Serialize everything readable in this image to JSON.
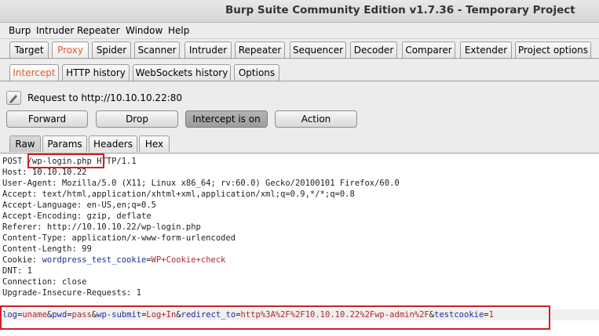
{
  "window": {
    "title": "Burp Suite Community Edition v1.7.36 - Temporary Project"
  },
  "menu": [
    "Burp",
    "Intruder",
    "Repeater",
    "Window",
    "Help"
  ],
  "main_tabs": [
    "Target",
    "Proxy",
    "Spider",
    "Scanner",
    "Intruder",
    "Repeater",
    "Sequencer",
    "Decoder",
    "Comparer",
    "Extender",
    "Project options"
  ],
  "proxy_tabs": [
    "Intercept",
    "HTTP history",
    "WebSockets history",
    "Options"
  ],
  "request_info": "Request to http://10.10.10.22:80",
  "buttons": {
    "forward": "Forward",
    "drop": "Drop",
    "intercept": "Intercept is on",
    "action": "Action"
  },
  "view_tabs": [
    "Raw",
    "Params",
    "Headers",
    "Hex"
  ],
  "request": {
    "method": "POST ",
    "path": "/wp-login.php",
    "protocol": " HTTP/1.1",
    "headers": [
      "Host: 10.10.10.22",
      "User-Agent: Mozilla/5.0 (X11; Linux x86_64; rv:60.0) Gecko/20100101 Firefox/60.0",
      "Accept: text/html,application/xhtml+xml,application/xml;q=0.9,*/*;q=0.8",
      "Accept-Language: en-US,en;q=0.5",
      "Accept-Encoding: gzip, deflate",
      "Referer: http://10.10.10.22/wp-login.php",
      "Content-Type: application/x-www-form-urlencoded",
      "Content-Length: 99"
    ],
    "cookie": {
      "prefix": "Cookie: ",
      "name": "wordpress_test_cookie",
      "eq": "=",
      "value": "WP+Cookie+check"
    },
    "headers_after": [
      "DNT: 1",
      "Connection: close",
      "Upgrade-Insecure-Requests: 1"
    ],
    "body": {
      "p1_name": "log",
      "p1_value": "uname",
      "p2_name": "pwd",
      "p2_value": "pass",
      "p3_name": "wp-submit",
      "p3_value": "Log+In",
      "p4_name": "redirect_to",
      "p4_value": "http%3A%2F%2F10.10.10.22%2Fwp-admin%2F",
      "p5_name": "testcookie",
      "p5_value": "1"
    }
  },
  "colors": {
    "active_tab": "#e35a2d",
    "param_name": "#1e2c9a",
    "param_value": "#b3262a",
    "highlight_box": "#d21f26"
  }
}
